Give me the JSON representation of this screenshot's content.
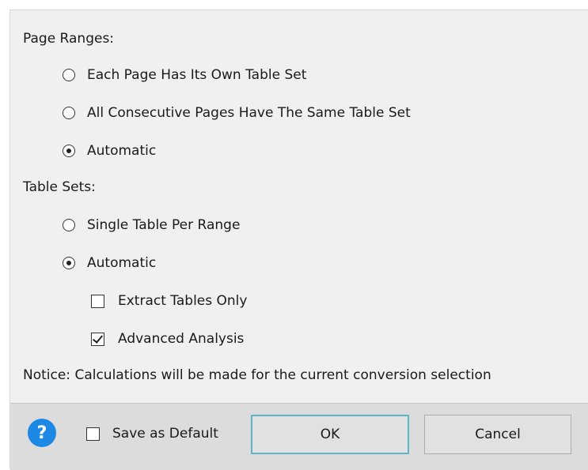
{
  "page_ranges": {
    "heading": "Page Ranges:",
    "options": [
      {
        "label": "Each Page Has Its Own Table Set",
        "selected": false
      },
      {
        "label": "All Consecutive Pages Have The Same Table Set",
        "selected": false
      },
      {
        "label": "Automatic",
        "selected": true
      }
    ]
  },
  "table_sets": {
    "heading": "Table Sets:",
    "options": [
      {
        "label": "Single Table Per Range",
        "selected": false
      },
      {
        "label": "Automatic",
        "selected": true
      }
    ],
    "sub_options": [
      {
        "label": "Extract Tables Only",
        "checked": false
      },
      {
        "label": "Advanced Analysis",
        "checked": true
      }
    ]
  },
  "notice": "Notice: Calculations will be made for the current conversion selection",
  "footer": {
    "help_icon": "?",
    "save_default_label": "Save as Default",
    "save_default_checked": false,
    "ok_label": "OK",
    "cancel_label": "Cancel"
  },
  "colors": {
    "dialog_bg": "#f0f0f0",
    "footer_bg": "#dcdcdc",
    "help_blue": "#1e88e5",
    "ok_border": "#5bb8c9"
  }
}
